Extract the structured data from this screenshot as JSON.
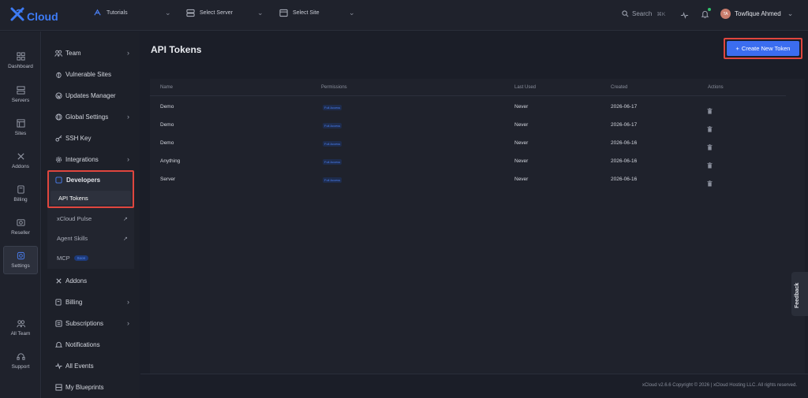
{
  "topbar": {
    "brand": "Cloud",
    "selectors": [
      {
        "label": "Tutorials"
      },
      {
        "label": "Select Server"
      },
      {
        "label": "Select Site"
      }
    ],
    "search_label": "Search",
    "search_shortcut": "⌘K",
    "user_initials": "TA",
    "user_name": "Towfique Ahmed"
  },
  "leftnav": {
    "items": [
      {
        "label": "Dashboard",
        "icon": "dashboard-icon"
      },
      {
        "label": "Servers",
        "icon": "servers-icon"
      },
      {
        "label": "Sites",
        "icon": "sites-icon"
      },
      {
        "label": "Addons",
        "icon": "addons-icon"
      },
      {
        "label": "Billing",
        "icon": "billing-icon"
      },
      {
        "label": "Reseller",
        "icon": "reseller-icon"
      },
      {
        "label": "Settings",
        "icon": "settings-icon",
        "active": true
      },
      {
        "label": "All Team",
        "icon": "team-icon"
      },
      {
        "label": "Support",
        "icon": "support-icon"
      }
    ]
  },
  "settings_nav": {
    "items": [
      {
        "label": "Team",
        "icon": "team-icon",
        "has_submenu": true
      },
      {
        "label": "Vulnerable Sites",
        "icon": "bug-icon",
        "has_submenu": false
      },
      {
        "label": "Updates Manager",
        "icon": "wordpress-icon",
        "has_submenu": false
      },
      {
        "label": "Global Settings",
        "icon": "globe-icon",
        "has_submenu": true
      },
      {
        "label": "SSH Key",
        "icon": "key-icon",
        "has_submenu": false
      },
      {
        "label": "Integrations",
        "icon": "gear-icon",
        "has_submenu": true
      }
    ],
    "developers": {
      "label": "Developers",
      "active_sub": "API Tokens",
      "subitems": [
        {
          "label": "xCloud Pulse",
          "external": true
        },
        {
          "label": "Agent Skills",
          "external": true
        },
        {
          "label": "MCP",
          "badge": "Soon"
        }
      ]
    },
    "items_after": [
      {
        "label": "Addons",
        "icon": "addons-icon",
        "has_submenu": false
      },
      {
        "label": "Billing",
        "icon": "billing-icon",
        "has_submenu": true
      },
      {
        "label": "Subscriptions",
        "icon": "subscriptions-icon",
        "has_submenu": true
      },
      {
        "label": "Notifications",
        "icon": "bell-icon",
        "has_submenu": false
      },
      {
        "label": "All Events",
        "icon": "activity-icon",
        "has_submenu": false
      },
      {
        "label": "My Blueprints",
        "icon": "blueprint-icon",
        "has_submenu": false
      }
    ]
  },
  "main": {
    "title": "API Tokens",
    "create_button": "Create New Token",
    "table": {
      "headers": [
        "Name",
        "Permissions",
        "Last Used",
        "Created",
        "Actions"
      ],
      "rows": [
        {
          "name": "Demo",
          "permission": "Full Access",
          "last_used": "Never",
          "created": "2026-06-17"
        },
        {
          "name": "Demo",
          "permission": "Full Access",
          "last_used": "Never",
          "created": "2026-06-17"
        },
        {
          "name": "Demo",
          "permission": "Full Access",
          "last_used": "Never",
          "created": "2026-06-16"
        },
        {
          "name": "Anything",
          "permission": "Full Access",
          "last_used": "Never",
          "created": "2026-06-16"
        },
        {
          "name": "Server",
          "permission": "Full Access",
          "last_used": "Never",
          "created": "2026-06-16"
        }
      ]
    },
    "footer": "xCloud v2.6.6 Copyright © 2026 | xCloud Hosting LLC. All rights reserved."
  },
  "feedback_label": "Feedback",
  "colors": {
    "accent": "#3b6df0",
    "highlight_border": "#e0463e",
    "background": "#1b1e28"
  }
}
